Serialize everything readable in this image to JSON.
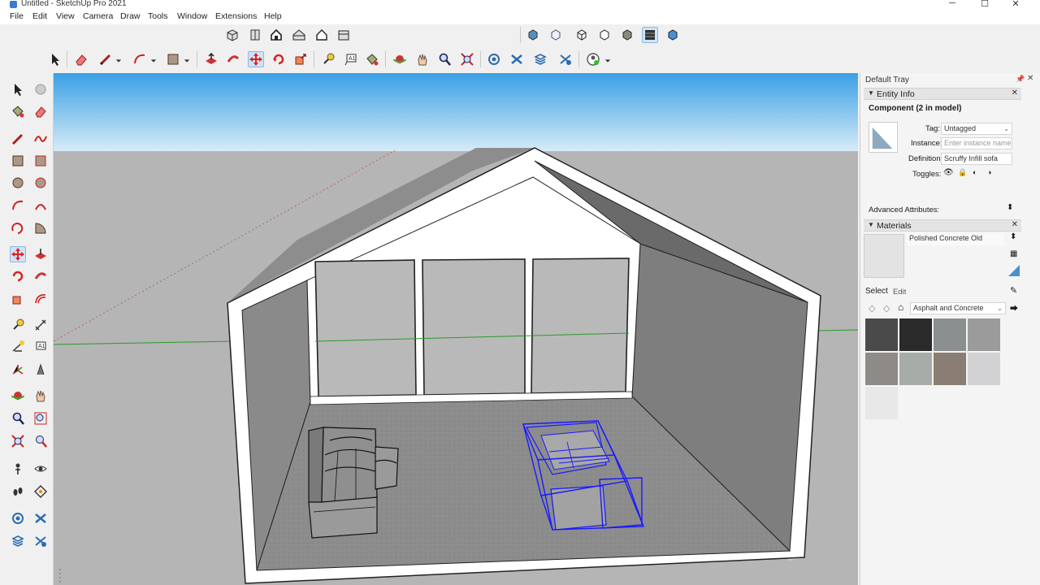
{
  "window": {
    "title": "Untitled - SketchUp Pro 2021",
    "minimize": "─",
    "maximize": "☐",
    "close": "✕"
  },
  "menu": [
    "File",
    "Edit",
    "View",
    "Camera",
    "Draw",
    "Tools",
    "Window",
    "Extensions",
    "Help"
  ],
  "tray": {
    "title": "Default Tray",
    "entity_info": {
      "header": "Entity Info",
      "entity": "Component (2 in model)",
      "tag_label": "Tag:",
      "tag_value": "Untagged",
      "instance_label": "Instance:",
      "instance_placeholder": "Enter instance name",
      "definition_label": "Definition:",
      "definition_value": "Scruffy Infill sofa",
      "toggles_label": "Toggles:",
      "advanced_label": "Advanced Attributes:"
    },
    "materials": {
      "header": "Materials",
      "current_name": "Polished Concrete Old",
      "tab_select": "Select",
      "tab_edit": "Edit",
      "collection": "Asphalt and Concrete",
      "swatch_colors": [
        "#4a4a4a",
        "#2a2a2a",
        "#8c8f90",
        "#9b9b9b",
        "#8e8a86",
        "#a8aca8",
        "#8a7e74",
        "#d2d2d4",
        "#e8e8e8"
      ]
    }
  },
  "colors": {
    "selection": "#1a1aff",
    "sky_top": "#4aa8e8",
    "ground": "#b8b8b8",
    "green_axis": "#2a9a2a"
  }
}
